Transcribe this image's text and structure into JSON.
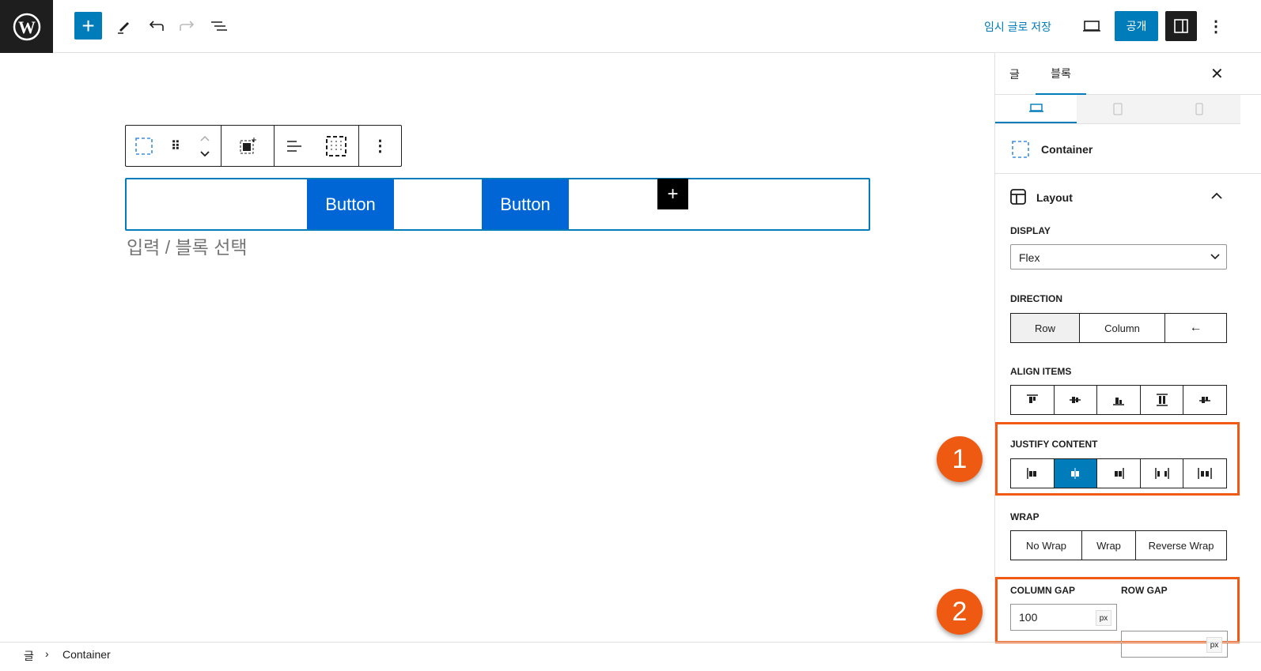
{
  "header": {
    "save_draft": "임시 글로 저장",
    "publish": "공개"
  },
  "canvas": {
    "buttons": [
      "Button",
      "Button"
    ],
    "placeholder": "입력 / 블록 선택"
  },
  "sidebar": {
    "tabs": [
      "글",
      "블록"
    ],
    "active_tab": "블록",
    "block_name": "Container",
    "panel_title": "Layout",
    "display": {
      "label": "DISPLAY",
      "value": "Flex"
    },
    "direction": {
      "label": "DIRECTION",
      "options": [
        "Row",
        "Column",
        "←"
      ],
      "selected": "Row"
    },
    "align_items": {
      "label": "ALIGN ITEMS",
      "icons": [
        "align-start-icon",
        "align-center-icon",
        "align-end-icon",
        "align-stretch-icon",
        "align-baseline-icon"
      ]
    },
    "justify_content": {
      "label": "JUSTIFY CONTENT",
      "icons": [
        "justify-start-icon",
        "justify-center-icon",
        "justify-end-icon",
        "justify-space-between-icon",
        "justify-space-around-icon"
      ],
      "selected_index": 1
    },
    "wrap": {
      "label": "WRAP",
      "options": [
        "No Wrap",
        "Wrap",
        "Reverse Wrap"
      ]
    },
    "column_gap": {
      "label": "COLUMN GAP",
      "value": "100",
      "unit": "px"
    },
    "row_gap": {
      "label": "ROW GAP",
      "value": "",
      "unit": "px"
    }
  },
  "annotations": [
    "1",
    "2"
  ],
  "breadcrumb": [
    "글",
    "Container"
  ],
  "colors": {
    "accent": "#007cba",
    "button": "#0066d6",
    "annotation": "#f05a14"
  }
}
